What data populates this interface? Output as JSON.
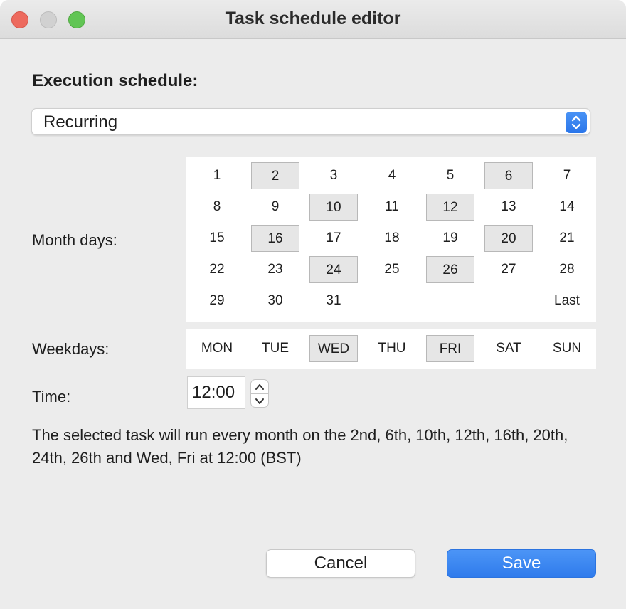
{
  "window": {
    "title": "Task schedule editor"
  },
  "schedule": {
    "heading": "Execution schedule:",
    "selected_option": "Recurring"
  },
  "month_days": {
    "label": "Month days:",
    "cells": [
      {
        "label": "1",
        "selected": false
      },
      {
        "label": "2",
        "selected": true
      },
      {
        "label": "3",
        "selected": false
      },
      {
        "label": "4",
        "selected": false
      },
      {
        "label": "5",
        "selected": false
      },
      {
        "label": "6",
        "selected": true
      },
      {
        "label": "7",
        "selected": false
      },
      {
        "label": "8",
        "selected": false
      },
      {
        "label": "9",
        "selected": false
      },
      {
        "label": "10",
        "selected": true
      },
      {
        "label": "11",
        "selected": false
      },
      {
        "label": "12",
        "selected": true
      },
      {
        "label": "13",
        "selected": false
      },
      {
        "label": "14",
        "selected": false
      },
      {
        "label": "15",
        "selected": false
      },
      {
        "label": "16",
        "selected": true
      },
      {
        "label": "17",
        "selected": false
      },
      {
        "label": "18",
        "selected": false
      },
      {
        "label": "19",
        "selected": false
      },
      {
        "label": "20",
        "selected": true
      },
      {
        "label": "21",
        "selected": false
      },
      {
        "label": "22",
        "selected": false
      },
      {
        "label": "23",
        "selected": false
      },
      {
        "label": "24",
        "selected": true
      },
      {
        "label": "25",
        "selected": false
      },
      {
        "label": "26",
        "selected": true
      },
      {
        "label": "27",
        "selected": false
      },
      {
        "label": "28",
        "selected": false
      },
      {
        "label": "29",
        "selected": false
      },
      {
        "label": "30",
        "selected": false
      },
      {
        "label": "31",
        "selected": false
      },
      {
        "label": "",
        "selected": false
      },
      {
        "label": "",
        "selected": false
      },
      {
        "label": "",
        "selected": false
      },
      {
        "label": "Last",
        "selected": false
      }
    ]
  },
  "weekdays": {
    "label": "Weekdays:",
    "items": [
      {
        "label": "MON",
        "selected": false
      },
      {
        "label": "TUE",
        "selected": false
      },
      {
        "label": "WED",
        "selected": true
      },
      {
        "label": "THU",
        "selected": false
      },
      {
        "label": "FRI",
        "selected": true
      },
      {
        "label": "SAT",
        "selected": false
      },
      {
        "label": "SUN",
        "selected": false
      }
    ]
  },
  "time": {
    "label": "Time:",
    "value": "12:00"
  },
  "summary": {
    "text": "The selected task will run every month on the 2nd, 6th, 10th, 12th, 16th, 20th, 24th, 26th and Wed, Fri at 12:00 (BST)"
  },
  "buttons": {
    "cancel_label": "Cancel",
    "save_label": "Save"
  },
  "colors": {
    "accent": "#2f7bec",
    "selected_cell": "#e6e6e6",
    "window_bg": "#ececec"
  }
}
